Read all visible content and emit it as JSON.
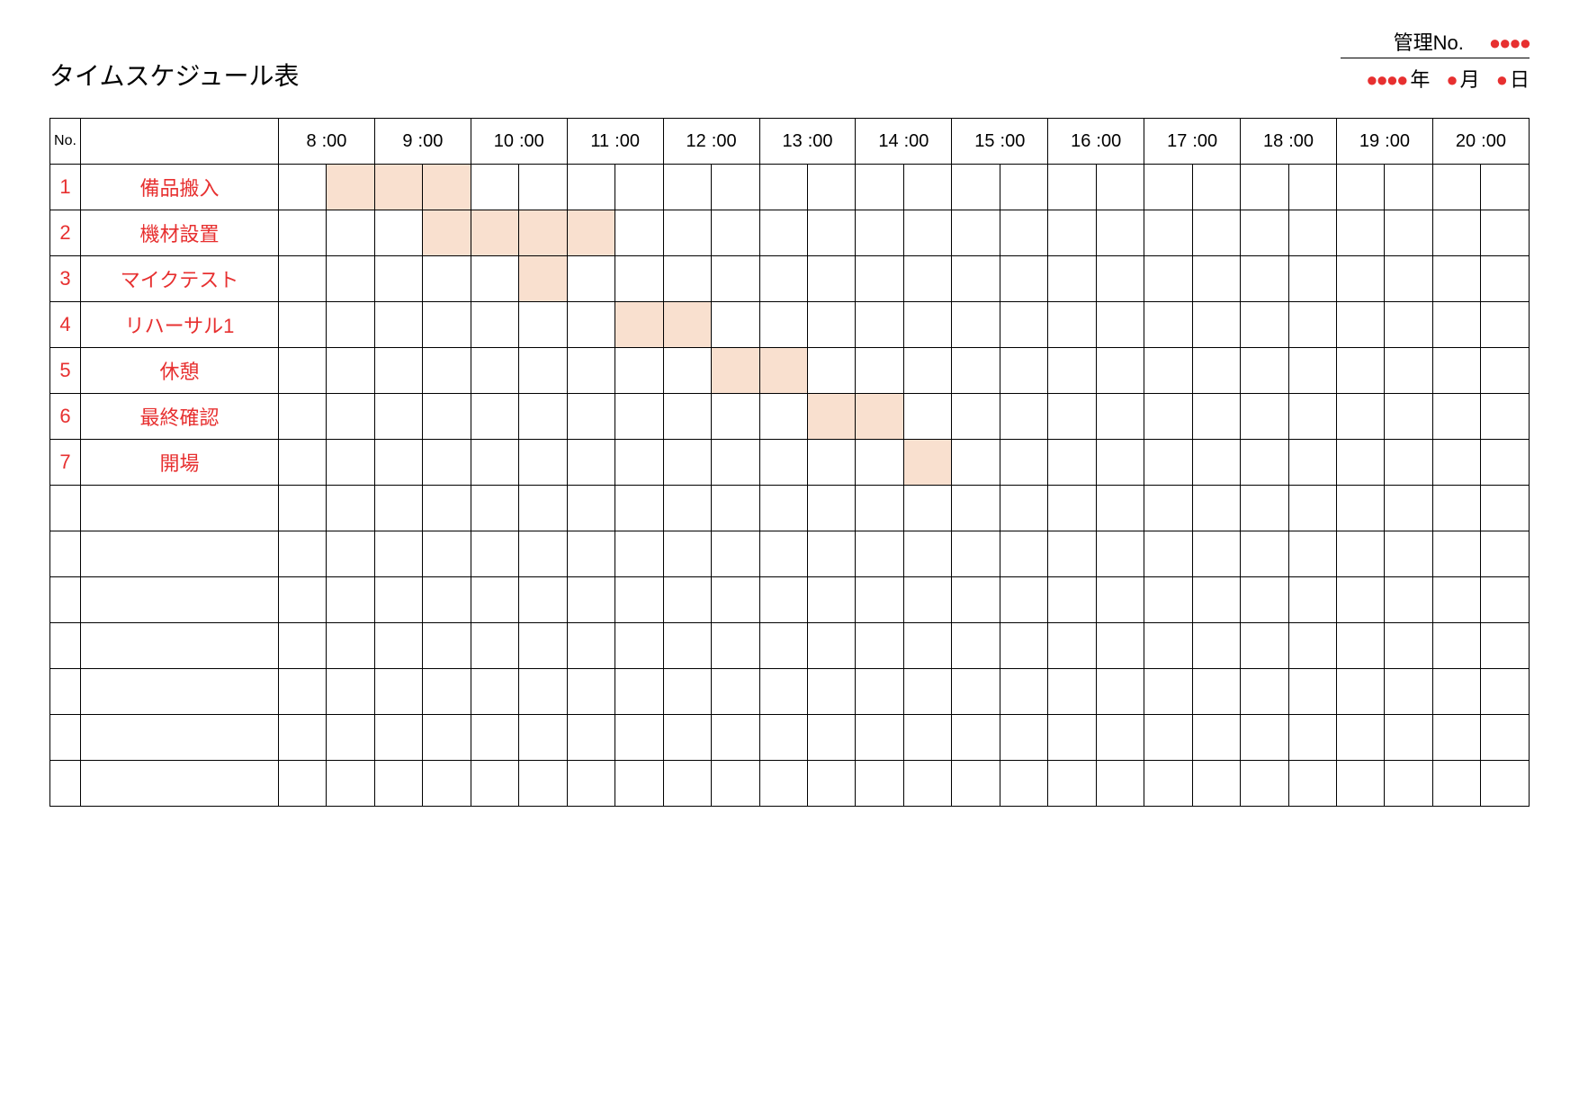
{
  "title": "タイムスケジュール表",
  "meta": {
    "mgmt_label": "管理No.",
    "mgmt_dots": "●●●●",
    "year_dots": "●●●●",
    "year_label": "年",
    "month_dot": "●",
    "month_label": "月",
    "day_dot": "●",
    "day_label": "日"
  },
  "header": {
    "no_label": "No.",
    "hours": [
      "8",
      "9",
      "10",
      "11",
      "12",
      "13",
      "14",
      "15",
      "16",
      "17",
      "18",
      "19",
      "20"
    ],
    "hour_suffix": ":00"
  },
  "rows": [
    {
      "num": "1",
      "task": "備品搬入",
      "shade": [
        1,
        2,
        3
      ]
    },
    {
      "num": "2",
      "task": "機材設置",
      "shade": [
        3,
        4,
        5,
        6
      ]
    },
    {
      "num": "3",
      "task": "マイクテスト",
      "shade": [
        5
      ]
    },
    {
      "num": "4",
      "task": "リハーサル1",
      "shade": [
        7,
        8
      ]
    },
    {
      "num": "5",
      "task": "休憩",
      "shade": [
        9,
        10
      ]
    },
    {
      "num": "6",
      "task": "最終確認",
      "shade": [
        11,
        12
      ]
    },
    {
      "num": "7",
      "task": "開場",
      "shade": [
        13
      ]
    },
    {
      "num": "",
      "task": "",
      "shade": []
    },
    {
      "num": "",
      "task": "",
      "shade": []
    },
    {
      "num": "",
      "task": "",
      "shade": []
    },
    {
      "num": "",
      "task": "",
      "shade": []
    },
    {
      "num": "",
      "task": "",
      "shade": []
    },
    {
      "num": "",
      "task": "",
      "shade": []
    },
    {
      "num": "",
      "task": "",
      "shade": []
    }
  ],
  "slots_per_hour": 2,
  "total_slots": 26
}
